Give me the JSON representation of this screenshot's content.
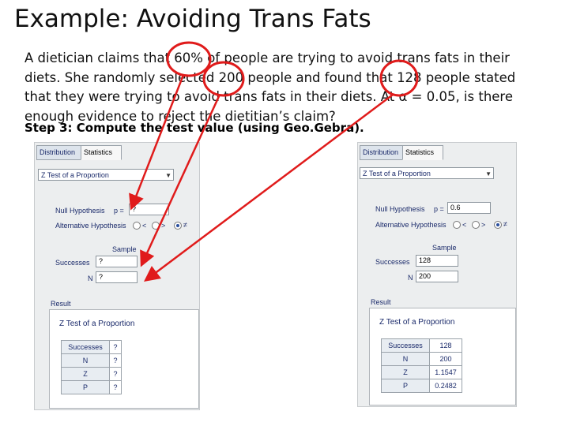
{
  "slide": {
    "title": "Example: Avoiding Trans Fats",
    "paragraph": "A dietician claims that 60% of people are trying to avoid trans fats in their diets. She randomly selected 200 people and found that 128 people stated that they were trying to avoid trans fats in their diets. At α = 0.05, is there enough evidence to reject the dietitian’s claim?",
    "step": "Step 3: Compute the test value (using Geo.Gebra)."
  },
  "left_panel": {
    "tab_distribution": "Distribution",
    "tab_statistics": "Statistics",
    "test_select": "Z Test of a Proportion",
    "null_hypothesis_label": "Null Hypothesis",
    "p_label": "p =",
    "p_value": "?",
    "alt_hypothesis_label": "Alternative Hypothesis",
    "alt_less": "<",
    "alt_greater": ">",
    "alt_neq": "≠",
    "sample_label": "Sample",
    "successes_label": "Successes",
    "successes_value": "?",
    "n_label": "N",
    "n_value": "?",
    "result_label": "Result",
    "result_title": "Z Test of a Proportion",
    "rows": [
      {
        "name": "Successes",
        "value": "?"
      },
      {
        "name": "N",
        "value": "?"
      },
      {
        "name": "Z",
        "value": "?"
      },
      {
        "name": "P",
        "value": "?"
      }
    ]
  },
  "right_panel": {
    "tab_distribution": "Distribution",
    "tab_statistics": "Statistics",
    "test_select": "Z Test of a Proportion",
    "null_hypothesis_label": "Null Hypothesis",
    "p_label": "p =",
    "p_value": "0.6",
    "alt_hypothesis_label": "Alternative Hypothesis",
    "alt_less": "<",
    "alt_greater": ">",
    "alt_neq": "≠",
    "sample_label": "Sample",
    "successes_label": "Successes",
    "successes_value": "128",
    "n_label": "N",
    "n_value": "200",
    "result_label": "Result",
    "result_title": "Z Test of a Proportion",
    "rows": [
      {
        "name": "Successes",
        "value": "128"
      },
      {
        "name": "N",
        "value": "200"
      },
      {
        "name": "Z",
        "value": "1.1547"
      },
      {
        "name": "P",
        "value": "0.2482"
      }
    ]
  },
  "colors": {
    "annotation_red": "#e01b1b",
    "panel_bg": "#eceeef",
    "label_blue": "#1a2a6a"
  }
}
